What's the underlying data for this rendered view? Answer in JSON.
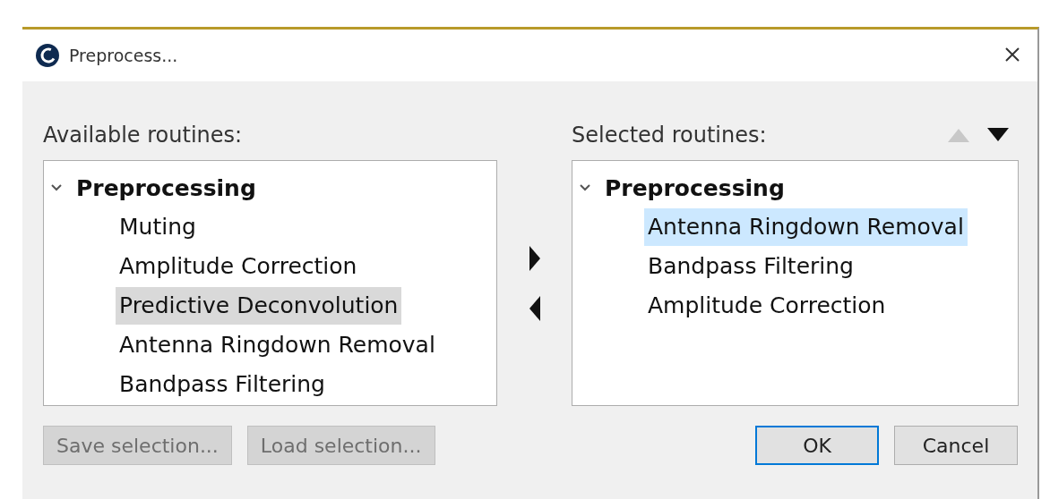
{
  "window": {
    "title": "Preprocess..."
  },
  "available": {
    "label": "Available routines:",
    "tree": [
      {
        "label": "Preprocessing",
        "expanded": true,
        "children": [
          {
            "label": "Muting",
            "selected": false
          },
          {
            "label": "Amplitude Correction",
            "selected": false
          },
          {
            "label": "Predictive Deconvolution",
            "selected": true
          },
          {
            "label": "Antenna Ringdown Removal",
            "selected": false
          },
          {
            "label": "Bandpass Filtering",
            "selected": false
          }
        ]
      }
    ]
  },
  "selected_list": {
    "label": "Selected routines:",
    "move_up": {
      "disabled": true
    },
    "move_down": {
      "disabled": false
    },
    "tree": [
      {
        "label": "Preprocessing",
        "expanded": true,
        "children": [
          {
            "label": "Antenna Ringdown Removal",
            "selected": true
          },
          {
            "label": "Bandpass Filtering",
            "selected": false
          },
          {
            "label": "Amplitude Correction",
            "selected": false
          }
        ]
      }
    ]
  },
  "buttons": [
    {
      "label": "Save selection...",
      "disabled": true,
      "default": false
    },
    {
      "label": "Load selection...",
      "disabled": true,
      "default": false
    },
    {
      "label": "OK",
      "disabled": false,
      "default": true
    },
    {
      "label": "Cancel",
      "disabled": false,
      "default": false
    }
  ]
}
